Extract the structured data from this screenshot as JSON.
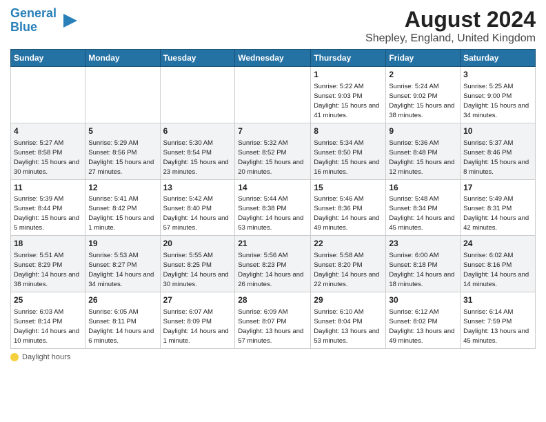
{
  "header": {
    "logo_line1": "General",
    "logo_line2": "Blue",
    "main_title": "August 2024",
    "subtitle": "Shepley, England, United Kingdom"
  },
  "calendar": {
    "days_of_week": [
      "Sunday",
      "Monday",
      "Tuesday",
      "Wednesday",
      "Thursday",
      "Friday",
      "Saturday"
    ],
    "weeks": [
      [
        {
          "day": "",
          "info": ""
        },
        {
          "day": "",
          "info": ""
        },
        {
          "day": "",
          "info": ""
        },
        {
          "day": "",
          "info": ""
        },
        {
          "day": "1",
          "info": "Sunrise: 5:22 AM\nSunset: 9:03 PM\nDaylight: 15 hours and 41 minutes."
        },
        {
          "day": "2",
          "info": "Sunrise: 5:24 AM\nSunset: 9:02 PM\nDaylight: 15 hours and 38 minutes."
        },
        {
          "day": "3",
          "info": "Sunrise: 5:25 AM\nSunset: 9:00 PM\nDaylight: 15 hours and 34 minutes."
        }
      ],
      [
        {
          "day": "4",
          "info": "Sunrise: 5:27 AM\nSunset: 8:58 PM\nDaylight: 15 hours and 30 minutes."
        },
        {
          "day": "5",
          "info": "Sunrise: 5:29 AM\nSunset: 8:56 PM\nDaylight: 15 hours and 27 minutes."
        },
        {
          "day": "6",
          "info": "Sunrise: 5:30 AM\nSunset: 8:54 PM\nDaylight: 15 hours and 23 minutes."
        },
        {
          "day": "7",
          "info": "Sunrise: 5:32 AM\nSunset: 8:52 PM\nDaylight: 15 hours and 20 minutes."
        },
        {
          "day": "8",
          "info": "Sunrise: 5:34 AM\nSunset: 8:50 PM\nDaylight: 15 hours and 16 minutes."
        },
        {
          "day": "9",
          "info": "Sunrise: 5:36 AM\nSunset: 8:48 PM\nDaylight: 15 hours and 12 minutes."
        },
        {
          "day": "10",
          "info": "Sunrise: 5:37 AM\nSunset: 8:46 PM\nDaylight: 15 hours and 8 minutes."
        }
      ],
      [
        {
          "day": "11",
          "info": "Sunrise: 5:39 AM\nSunset: 8:44 PM\nDaylight: 15 hours and 5 minutes."
        },
        {
          "day": "12",
          "info": "Sunrise: 5:41 AM\nSunset: 8:42 PM\nDaylight: 15 hours and 1 minute."
        },
        {
          "day": "13",
          "info": "Sunrise: 5:42 AM\nSunset: 8:40 PM\nDaylight: 14 hours and 57 minutes."
        },
        {
          "day": "14",
          "info": "Sunrise: 5:44 AM\nSunset: 8:38 PM\nDaylight: 14 hours and 53 minutes."
        },
        {
          "day": "15",
          "info": "Sunrise: 5:46 AM\nSunset: 8:36 PM\nDaylight: 14 hours and 49 minutes."
        },
        {
          "day": "16",
          "info": "Sunrise: 5:48 AM\nSunset: 8:34 PM\nDaylight: 14 hours and 45 minutes."
        },
        {
          "day": "17",
          "info": "Sunrise: 5:49 AM\nSunset: 8:31 PM\nDaylight: 14 hours and 42 minutes."
        }
      ],
      [
        {
          "day": "18",
          "info": "Sunrise: 5:51 AM\nSunset: 8:29 PM\nDaylight: 14 hours and 38 minutes."
        },
        {
          "day": "19",
          "info": "Sunrise: 5:53 AM\nSunset: 8:27 PM\nDaylight: 14 hours and 34 minutes."
        },
        {
          "day": "20",
          "info": "Sunrise: 5:55 AM\nSunset: 8:25 PM\nDaylight: 14 hours and 30 minutes."
        },
        {
          "day": "21",
          "info": "Sunrise: 5:56 AM\nSunset: 8:23 PM\nDaylight: 14 hours and 26 minutes."
        },
        {
          "day": "22",
          "info": "Sunrise: 5:58 AM\nSunset: 8:20 PM\nDaylight: 14 hours and 22 minutes."
        },
        {
          "day": "23",
          "info": "Sunrise: 6:00 AM\nSunset: 8:18 PM\nDaylight: 14 hours and 18 minutes."
        },
        {
          "day": "24",
          "info": "Sunrise: 6:02 AM\nSunset: 8:16 PM\nDaylight: 14 hours and 14 minutes."
        }
      ],
      [
        {
          "day": "25",
          "info": "Sunrise: 6:03 AM\nSunset: 8:14 PM\nDaylight: 14 hours and 10 minutes."
        },
        {
          "day": "26",
          "info": "Sunrise: 6:05 AM\nSunset: 8:11 PM\nDaylight: 14 hours and 6 minutes."
        },
        {
          "day": "27",
          "info": "Sunrise: 6:07 AM\nSunset: 8:09 PM\nDaylight: 14 hours and 1 minute."
        },
        {
          "day": "28",
          "info": "Sunrise: 6:09 AM\nSunset: 8:07 PM\nDaylight: 13 hours and 57 minutes."
        },
        {
          "day": "29",
          "info": "Sunrise: 6:10 AM\nSunset: 8:04 PM\nDaylight: 13 hours and 53 minutes."
        },
        {
          "day": "30",
          "info": "Sunrise: 6:12 AM\nSunset: 8:02 PM\nDaylight: 13 hours and 49 minutes."
        },
        {
          "day": "31",
          "info": "Sunrise: 6:14 AM\nSunset: 7:59 PM\nDaylight: 13 hours and 45 minutes."
        }
      ]
    ]
  },
  "footer": {
    "daylight_label": "Daylight hours"
  }
}
